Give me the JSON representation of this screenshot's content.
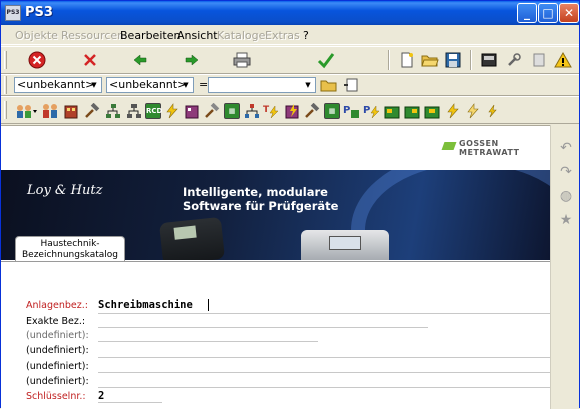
{
  "window": {
    "title": "PS3",
    "app_icon_text": "PS3"
  },
  "menu": [
    {
      "label": "Objekte",
      "enabled": false
    },
    {
      "label": "Ressourcen",
      "enabled": false
    },
    {
      "label": "Bearbeiten",
      "enabled": true
    },
    {
      "label": "Ansicht",
      "enabled": true
    },
    {
      "label": "Kataloge",
      "enabled": false
    },
    {
      "label": "Extras",
      "enabled": false
    },
    {
      "label": "?",
      "enabled": true
    }
  ],
  "filterbar": {
    "combo1": "<unbekannt>",
    "combo2": "<unbekannt>",
    "eq": "=",
    "combo3": ""
  },
  "brand": {
    "company": "GOSSEN METRAWATT",
    "logo": "Loy & Hutz",
    "headline1": "Intelligente, modulare",
    "headline2": "Software für Prüfgeräte"
  },
  "tab": {
    "label1": "Haustechnik-",
    "label2": "Bezeichnungskatalog"
  },
  "form": {
    "anlagenbez_label": "Anlagenbez.:",
    "anlagenbez_value": "Schreibmaschine",
    "exakte_label": "Exakte Bez.:",
    "undef1_label": "(undefiniert):",
    "undef2_label": "(undefiniert):",
    "undef3_label": "(undefiniert):",
    "undef4_label": "(undefiniert):",
    "schluessel_label": "Schlüsselnr.:",
    "schluessel_value": "2"
  },
  "colors": {
    "title_blue": "#0A4EC9",
    "required_red": "#C02020",
    "gossen_green": "#7CBF3A"
  }
}
